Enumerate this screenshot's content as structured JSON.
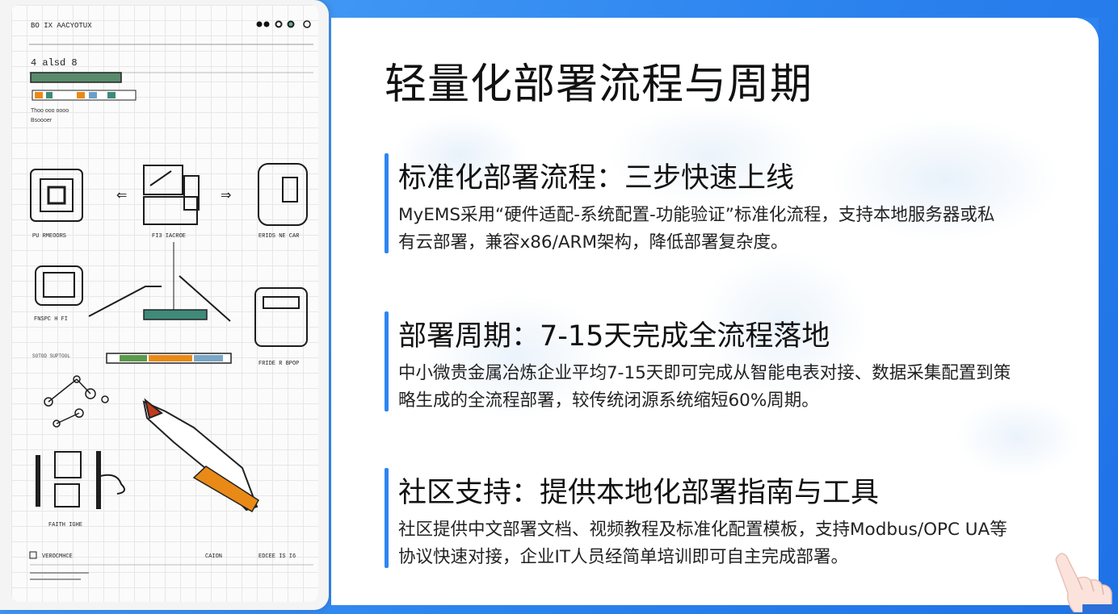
{
  "page": {
    "title": "轻量化部署流程与周期"
  },
  "sections": [
    {
      "heading": "标准化部署流程：三步快速上线",
      "body_line1": "MyEMS采用“硬件适配-系统配置-功能验证”标准化流程，支持本地服务器或私",
      "body_line2": "有云部署，兼容x86/ARM架构，降低部署复杂度。"
    },
    {
      "heading": "部署周期：7-15天完成全流程落地",
      "body_line1": "中小微贵金属冶炼企业平均7-15天即可完成从智能电表对接、数据采集配置到策",
      "body_line2": "略生成的全流程部署，较传统闭源系统缩短60%周期。"
    },
    {
      "heading": "社区支持：提供本地化部署指南与工具",
      "body_line1": "社区提供中文部署文档、视频教程及标准化配置模板，支持Modbus/OPC UA等",
      "body_line2": "协议快速对接，企业IT人员经简单培训即可自主完成部署。"
    }
  ],
  "illustration": {
    "header": "BO IX AACYOTUX",
    "subheader": "4 alsd 8",
    "caption_1": "Thoo ooo oooo",
    "caption_2": "Bsoooer",
    "label_a": "PU RMEOORS",
    "label_b": "FI3 IACROE",
    "label_c": "ERIDS NE CAR",
    "label_d": "FNSPC H FI",
    "label_e": "FRIDE R BPOP",
    "label_f": "FAITH IGHE",
    "label_g": "VEROCMHCE",
    "label_h": "CAION",
    "label_i": "EDCEE IS I6",
    "label_j": "SOTOD SUPTOOL"
  },
  "colors": {
    "accent": "#2d86f2",
    "background_blue": "#2c84ef",
    "orange": "#e98a17",
    "teal": "#3f8a7a"
  }
}
